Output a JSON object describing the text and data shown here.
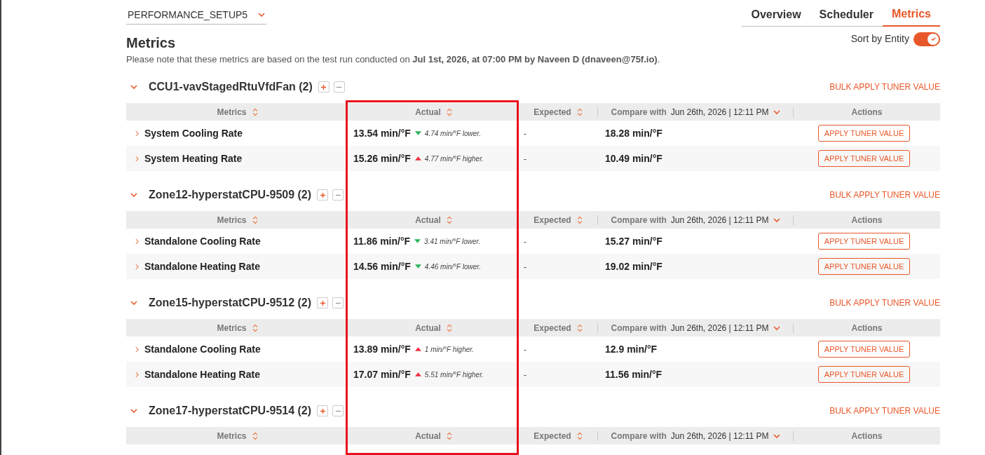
{
  "setup_dropdown": {
    "value": "PERFORMANCE_SETUP5"
  },
  "tabs": [
    {
      "label": "Overview",
      "selected": false
    },
    {
      "label": "Scheduler",
      "selected": false
    },
    {
      "label": "Metrics",
      "selected": true
    }
  ],
  "page_title": "Metrics",
  "note": "Please note that these metrics are based on the test run conducted on **Jul 1st, 2026, at 07:00 PM by Naveen D (dnaveen@75f.io)**.",
  "sort_toggle": {
    "label": "Sort by Entity",
    "on": true
  },
  "groups": [
    {
      "name": "CCU1-vavStagedRtuVfdFan (2)",
      "expanded": true,
      "bulk_action": "BULK APPLY TUNER VALUE",
      "columns": {
        "metrics": "Metrics",
        "actual": "Actual",
        "expected": "Expected",
        "compare_label": "Compare with",
        "compare_value": "Jun 26th, 2026 | 12:11 PM",
        "actions": "Actions"
      },
      "rows": [
        {
          "metric": "System Cooling Rate",
          "actual": "13.54 min/°F",
          "decrease": true,
          "delta": "4.74 min/°F lower.",
          "expected": "-",
          "compare": "18.28 min/°F",
          "action": "APPLY TUNER VALUE"
        },
        {
          "metric": "System Heating Rate",
          "actual": "15.26 min/°F",
          "decrease": false,
          "delta": "4.77 min/°F higher.",
          "expected": "-",
          "compare": "10.49 min/°F",
          "action": "APPLY TUNER VALUE"
        }
      ]
    },
    {
      "name": "Zone12-hyperstatCPU-9509 (2)",
      "expanded": true,
      "bulk_action": "BULK APPLY TUNER VALUE",
      "columns": {
        "metrics": "Metrics",
        "actual": "Actual",
        "expected": "Expected",
        "compare_label": "Compare with",
        "compare_value": "Jun 26th, 2026 | 12:11 PM",
        "actions": "Actions"
      },
      "rows": [
        {
          "metric": "Standalone Cooling Rate",
          "actual": "11.86 min/°F",
          "decrease": true,
          "delta": "3.41 min/°F lower.",
          "expected": "-",
          "compare": "15.27 min/°F",
          "action": "APPLY TUNER VALUE"
        },
        {
          "metric": "Standalone Heating Rate",
          "actual": "14.56 min/°F",
          "decrease": true,
          "delta": "4.46 min/°F lower.",
          "expected": "-",
          "compare": "19.02 min/°F",
          "action": "APPLY TUNER VALUE"
        }
      ]
    },
    {
      "name": "Zone15-hyperstatCPU-9512 (2)",
      "expanded": true,
      "bulk_action": "BULK APPLY TUNER VALUE",
      "columns": {
        "metrics": "Metrics",
        "actual": "Actual",
        "expected": "Expected",
        "compare_label": "Compare with",
        "compare_value": "Jun 26th, 2026 | 12:11 PM",
        "actions": "Actions"
      },
      "rows": [
        {
          "metric": "Standalone Cooling Rate",
          "actual": "13.89 min/°F",
          "decrease": false,
          "delta": "1 min/°F higher.",
          "expected": "-",
          "compare": "12.9 min/°F",
          "action": "APPLY TUNER VALUE"
        },
        {
          "metric": "Standalone Heating Rate",
          "actual": "17.07 min/°F",
          "decrease": false,
          "delta": "5.51 min/°F higher.",
          "expected": "-",
          "compare": "11.56 min/°F",
          "action": "APPLY TUNER VALUE"
        }
      ]
    },
    {
      "name": "Zone17-hyperstatCPU-9514 (2)",
      "expanded": true,
      "bulk_action": "BULK APPLY TUNER VALUE",
      "columns": {
        "metrics": "Metrics",
        "actual": "Actual",
        "expected": "Expected",
        "compare_label": "Compare with",
        "compare_value": "Jun 26th, 2026 | 12:11 PM",
        "actions": "Actions"
      }
    }
  ],
  "annotation": {
    "kind": "highlight"
  }
}
